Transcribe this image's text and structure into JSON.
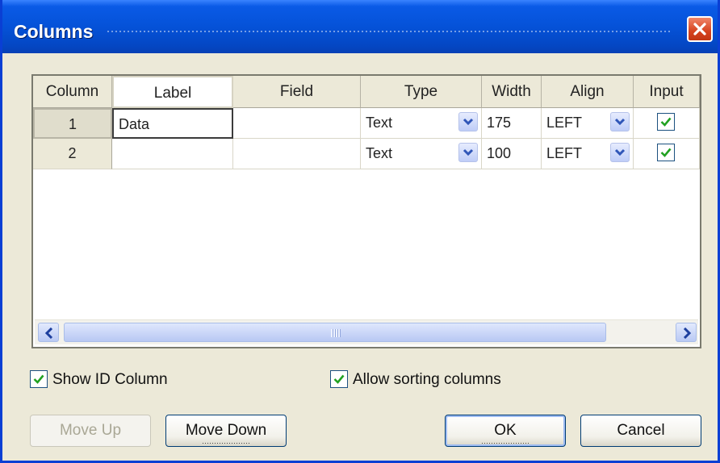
{
  "window": {
    "title": "Columns"
  },
  "grid": {
    "headers": [
      "Column",
      "Label",
      "Field",
      "Type",
      "Width",
      "Align",
      "Input"
    ],
    "rows": [
      {
        "num": "1",
        "label": "Data",
        "field": "",
        "type": "Text",
        "width": "175",
        "align": "LEFT",
        "input": true
      },
      {
        "num": "2",
        "label": "",
        "field": "",
        "type": "Text",
        "width": "100",
        "align": "LEFT",
        "input": true
      }
    ]
  },
  "options": {
    "show_id_column": {
      "label": "Show ID Column",
      "checked": true
    },
    "allow_sorting": {
      "label": "Allow sorting columns",
      "checked": true
    }
  },
  "buttons": {
    "move_up": "Move Up",
    "move_down": "Move Down",
    "ok": "OK",
    "cancel": "Cancel"
  },
  "icons": {
    "close": "close-icon",
    "dropdown": "chevron-down-icon",
    "check": "check-icon",
    "scroll_left": "arrow-left-icon",
    "scroll_right": "arrow-right-icon"
  },
  "colors": {
    "title_bar": "#0552d8",
    "close_button": "#d6431f",
    "dialog_bg": "#ECE9D8",
    "check": "#21a121"
  }
}
